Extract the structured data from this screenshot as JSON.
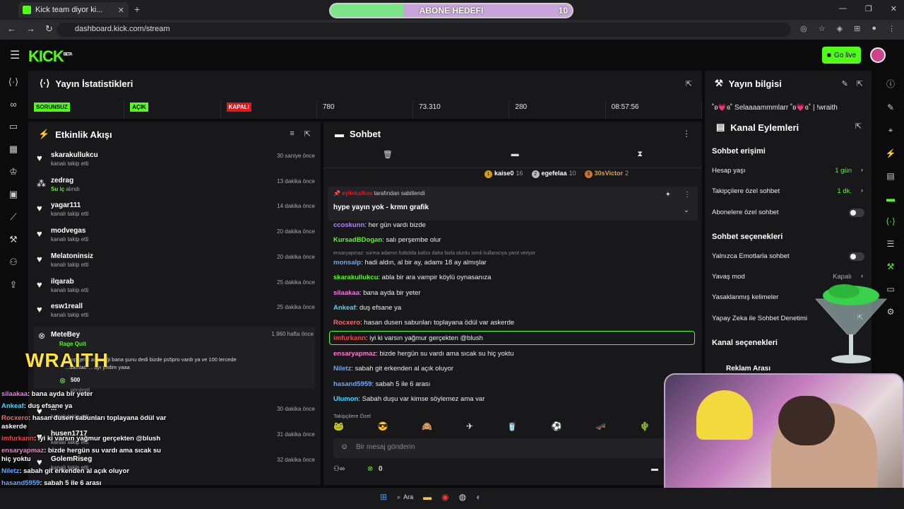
{
  "browser": {
    "tab_title": "Kick team diyor ki...",
    "tab_close": "✕",
    "new_tab": "+",
    "url": "dashboard.kick.com/stream",
    "win_controls": [
      "—",
      "❐",
      "✕"
    ]
  },
  "goal": {
    "label": "ABONE HEDEFI",
    "value": "10",
    "progress": 0.3
  },
  "topbar": {
    "logo": "KICK",
    "logo_sup": "BETA",
    "go_live": "Go live"
  },
  "stats": {
    "title": "Yayın İstatistikleri",
    "cells": [
      {
        "type": "badge-g",
        "text": "SORUNSUZ"
      },
      {
        "type": "badge-g",
        "text": "AÇIK"
      },
      {
        "type": "badge-r",
        "text": "KAPALI"
      },
      {
        "type": "text",
        "text": "780"
      },
      {
        "type": "text",
        "text": "73.310"
      },
      {
        "type": "text",
        "text": "280"
      },
      {
        "type": "text",
        "text": "08:57:56"
      }
    ]
  },
  "info": {
    "title": "Yayın bilgisi",
    "stream_title": "˚ʚ💗ɞ˚ Selaaaammmlarr ˚ʚ💗ɞ˚ | !wraith"
  },
  "events": {
    "title": "Etkinlik Akışı",
    "items": [
      {
        "name": "skarakullukcu",
        "sub": "kanalı takip etti",
        "time": "30 saniye önce",
        "icon": "heart-icon"
      },
      {
        "name": "zedrag",
        "sub": "Su iç",
        "sub2": "alındı",
        "time": "13 dakika önce",
        "icon": "reward-icon"
      },
      {
        "name": "yagar111",
        "sub": "kanalı takip etti",
        "time": "14 dakika önce",
        "icon": "heart-icon"
      },
      {
        "name": "modvegas",
        "sub": "kanalı takip etti",
        "time": "20 dakika önce",
        "icon": "heart-icon"
      },
      {
        "name": "Melatoninsiz",
        "sub": "kanalı takip etti",
        "time": "20 dakika önce",
        "icon": "heart-icon"
      },
      {
        "name": "ilqarab",
        "sub": "kanalı takip etti",
        "time": "25 dakika önce",
        "icon": "heart-icon"
      },
      {
        "name": "esw1reall",
        "sub": "kanalı takip etti",
        "time": "25 dakika önce",
        "icon": "heart-icon"
      }
    ],
    "mete": {
      "name": "MeteBey",
      "time": "1.960 hafta önce",
      "reward": "Rage Quit",
      "text1": "...pıp geldi askerliği bana şunu dedi bizde ps5pro vardı ya ve 100 lercede",
      "text2": "...damlatı ... ayı yedim yaaa",
      "cost": "500",
      "sent": "gönderdi"
    },
    "items2": [
      {
        "name": "...",
        "sub": "kanalı takip etti",
        "time": "30 dakika önce"
      },
      {
        "name": "husen1717",
        "sub": "kanalı takip etti",
        "time": "31 dakika önce"
      },
      {
        "name": "GolemRiseg",
        "sub": "kanalı takip etti",
        "time": "32 dakika önce"
      }
    ]
  },
  "chat": {
    "title": "Sohbet",
    "leaders": [
      {
        "rank": "1",
        "name": "kaise0",
        "n": "16"
      },
      {
        "rank": "2",
        "name": "egefelaa",
        "n": "10"
      },
      {
        "rank": "3",
        "name": "30sVictor",
        "n": "2"
      }
    ],
    "pinned_by": "eylinkafkas",
    "pinned_suffix": "tarafından sabitlendi",
    "pinned_msg": "hype yayın yok - krmn grafik",
    "messages": [
      {
        "user": "ccoskunn",
        "color": "#b084ff",
        "text": "her gün vardı bizde"
      },
      {
        "user": "KursadBDogan",
        "color": "#53fc18",
        "text": "salı perşembe olur"
      },
      {
        "user": "monsalp",
        "color": "#6aa8ff",
        "text": "hadi aldın, al bir ay, adamı 18 ay almışlar"
      },
      {
        "user": "skarakullukcu",
        "color": "#53fc18",
        "text": "abla bir ara vampir köylü oynasanıza"
      },
      {
        "user": "silaakaa",
        "color": "#f07be8",
        "text": "bana ayda bir yeter"
      },
      {
        "user": "Ankeaf",
        "color": "#4ad7ff",
        "text": "duş efsane ya"
      },
      {
        "user": "Rocxero",
        "color": "#ff6b6b",
        "text": "hasan dusen sabunları toplayana ödül var askerde"
      },
      {
        "user": "imfurkann",
        "color": "#ff4040",
        "text": "iyi ki varsın yağmur gerçekten @blush"
      },
      {
        "user": "ensaryapmaz",
        "color": "#ff7bd0",
        "text": "bizde hergün su vardı ama sıcak su hiç yoktu"
      },
      {
        "user": "Niletz",
        "color": "#6aa8ff",
        "text": "sabah git erkenden al açık oluyor"
      },
      {
        "user": "hasand5959",
        "color": "#6aa8ff",
        "text": "sabah 5 ile 6 arası"
      },
      {
        "user": "Ulumon",
        "color": "#4ad7ff",
        "text": "Sabah duşu var kimse söylemez ama var"
      }
    ],
    "reply_note": "ensaryapmaz: sorma adamın futbolda katlısı daha fazla olurdu isimli kullanıcıya yanıt veriyor",
    "followers_only": "Takipçilere Özel",
    "placeholder": "Bir mesaj gönderin",
    "points": "0"
  },
  "actions": {
    "title": "Kanal Eylemleri",
    "chat_access": "Sohbet erişimi",
    "account_age": "Hesap yaşı",
    "account_age_val": "1 gün",
    "followers_chat": "Takipçilere özel sohbet",
    "followers_chat_val": "1 dk.",
    "subs_chat": "Abonelere özel sohbet",
    "chat_options": "Sohbet seçenekleri",
    "emote_only": "Yalnızca Emotlarla sohbet",
    "slow_mode": "Yavaş mod",
    "slow_mode_val": "Kapalı",
    "banned_words": "Yasaklanmış kelimeler",
    "ai_moderation": "Yapay Zeka ile Sohbet Denetimi",
    "channel_options": "Kanal seçenekleri",
    "ad_break": "Reklam Arası"
  },
  "overlay": {
    "wraith": "WRAITH",
    "lines": [
      {
        "user": "silaakaa",
        "color": "#f07be8",
        "text": ": bana ayda bir yeter"
      },
      {
        "user": "Ankeaf",
        "color": "#4ad7ff",
        "text": ": duş efsane ya"
      },
      {
        "user": "Rocxero",
        "color": "#ff6b6b",
        "text": ": hasan dusen sabunları toplayana ödül var askerde"
      },
      {
        "user": "imfurkann",
        "color": "#ff4040",
        "text": ": iyi ki varsın yağmur gerçekten @blush"
      },
      {
        "user": "ensaryapmaz",
        "color": "#ff7bd0",
        "text": ": bizde hergün su vardı ama sıcak su hiç yoktu"
      },
      {
        "user": "Niletz",
        "color": "#6aa8ff",
        "text": ": sabah git erkenden al açık oluyor"
      },
      {
        "user": "hasand5959",
        "color": "#6aa8ff",
        "text": ": sabah 5 ile 6 arası"
      }
    ]
  },
  "taskbar": {
    "search": "Ara"
  }
}
